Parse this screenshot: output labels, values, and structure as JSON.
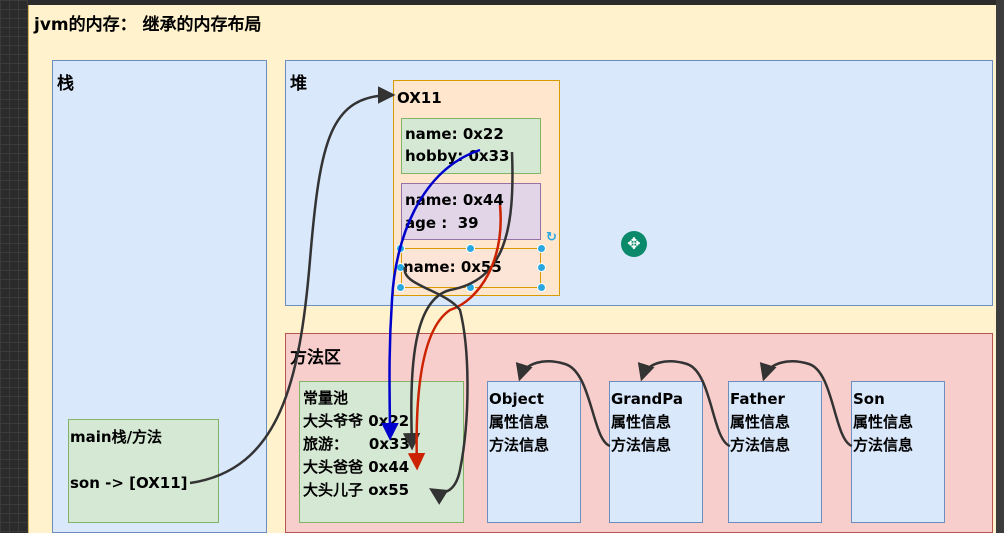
{
  "title": "jvm的内存： 继承的内存布局",
  "stack": {
    "label": "栈",
    "main_frame": {
      "title": "main栈/方法",
      "ref": "son -> [OX11]"
    }
  },
  "heap": {
    "label": "堆",
    "object": {
      "address": "OX11",
      "fields": [
        {
          "lines": [
            "name: 0x22",
            "hobby: 0x33"
          ]
        },
        {
          "lines": [
            "name: 0x44",
            "age :  39"
          ]
        },
        {
          "lines": [
            "name: 0x55"
          ]
        }
      ]
    }
  },
  "method_area": {
    "label": "方法区",
    "constant_pool": {
      "lines": [
        "常量池",
        "大头爷爷 0x22",
        "旅游：    0x33",
        "大头爸爸 0x44",
        "大头儿子 ox55"
      ]
    },
    "classes": [
      {
        "name": "Object",
        "attr": "属性信息",
        "method": "方法信息"
      },
      {
        "name": "GrandPa",
        "attr": "属性信息",
        "method": "方法信息"
      },
      {
        "name": "Father",
        "attr": "属性信息",
        "method": "方法信息"
      },
      {
        "name": "Son",
        "attr": "属性信息",
        "method": "方法信息"
      }
    ]
  },
  "colors": {
    "arrow_default": "#333333",
    "arrow_blue": "#0000cc",
    "arrow_red": "#cc2200"
  }
}
